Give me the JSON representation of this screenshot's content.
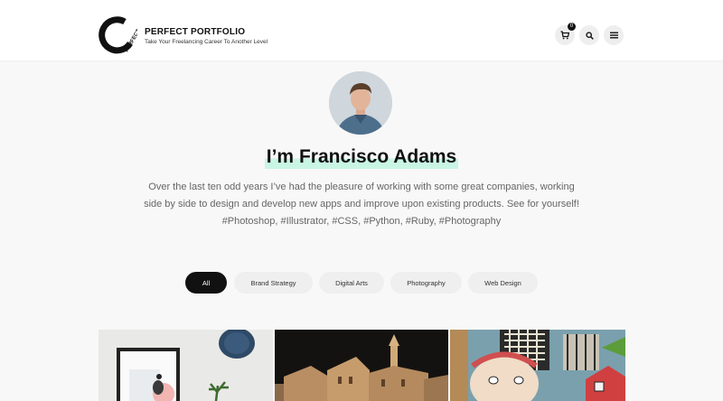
{
  "brand": {
    "title": "PERFECT PORTFOLIO",
    "tagline": "Take Your Freelancing Career To Another Level",
    "logo_text": "PERFECT"
  },
  "header_actions": {
    "cart_icon": "cart-icon",
    "cart_count": "0",
    "search_icon": "search-icon",
    "menu_icon": "hamburger-menu-icon"
  },
  "profile": {
    "heading": "I’m Francisco Adams",
    "bio_line1": "Over the last ten odd years I’ve had the pleasure of working with some great companies, working",
    "bio_line2": "side by side to design and develop new apps and improve upon existing products. See for yourself!",
    "bio_line3": "#Photoshop, #Illustrator, #CSS, #Python, #Ruby, #Photography"
  },
  "filters": [
    {
      "label": "All",
      "active": true
    },
    {
      "label": "Brand Strategy",
      "active": false
    },
    {
      "label": "Digital Arts",
      "active": false
    },
    {
      "label": "Photography",
      "active": false
    },
    {
      "label": "Web Design",
      "active": false
    }
  ],
  "colors": {
    "accent_highlight": "#c9f5e5",
    "active_chip": "#111111",
    "chip_bg": "#efefef"
  }
}
